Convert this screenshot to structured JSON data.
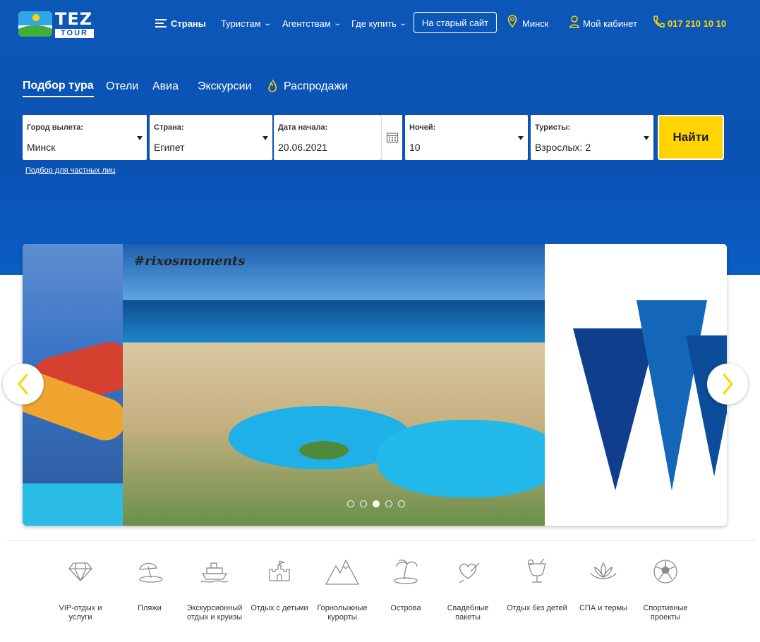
{
  "header": {
    "logo_main": "TEZ",
    "logo_sub": "TOUR",
    "nav": {
      "countries": "Страны",
      "tourists": "Туристам",
      "agencies": "Агентствам",
      "where_to_buy": "Где купить",
      "old_site": "На старый сайт",
      "city": "Минск",
      "cabinet": "Мой кабинет",
      "phone": "017 210 10 10"
    }
  },
  "search": {
    "tabs": [
      "Подбор тура",
      "Отели",
      "Авиа",
      "Экскурсии",
      "Распродажи"
    ],
    "active_tab": "Подбор тура",
    "fields": {
      "departure": {
        "label": "Город вылета:",
        "value": "Минск"
      },
      "country": {
        "label": "Страна:",
        "value": "Египет"
      },
      "start_date": {
        "label": "Дата начала:",
        "value": "20.06.2021"
      },
      "nights": {
        "label": "Ночей:",
        "value": "10"
      },
      "tourists": {
        "label": "Туристы:",
        "value": "Взрослых: 2"
      }
    },
    "find_button": "Найти",
    "private_link": "Подбор для частных лиц"
  },
  "slider": {
    "hashtag": "#rixosmoments",
    "slide_count": 5,
    "active_slide": 3
  },
  "categories": [
    {
      "icon": "diamond-icon",
      "label": "VIP-отдых и услуги"
    },
    {
      "icon": "beach-umbrella-icon",
      "label": "Пляжи"
    },
    {
      "icon": "cruise-ship-icon",
      "label": "Экскурсионный отдых и круизы"
    },
    {
      "icon": "castle-icon",
      "label": "Отдых с детьми"
    },
    {
      "icon": "mountains-icon",
      "label": "Горнолыжные курорты"
    },
    {
      "icon": "palm-island-icon",
      "label": "Острова"
    },
    {
      "icon": "heart-bouquet-icon",
      "label": "Свадебные пакеты"
    },
    {
      "icon": "cocktail-icon",
      "label": "Отдых без детей"
    },
    {
      "icon": "lotus-icon",
      "label": "СПА и термы"
    },
    {
      "icon": "soccer-ball-icon",
      "label": "Спортивные проекты"
    }
  ],
  "colors": {
    "brand_blue": "#0a52b3",
    "accent_yellow": "#ffd400",
    "icon_gray": "#8a8a8a"
  }
}
